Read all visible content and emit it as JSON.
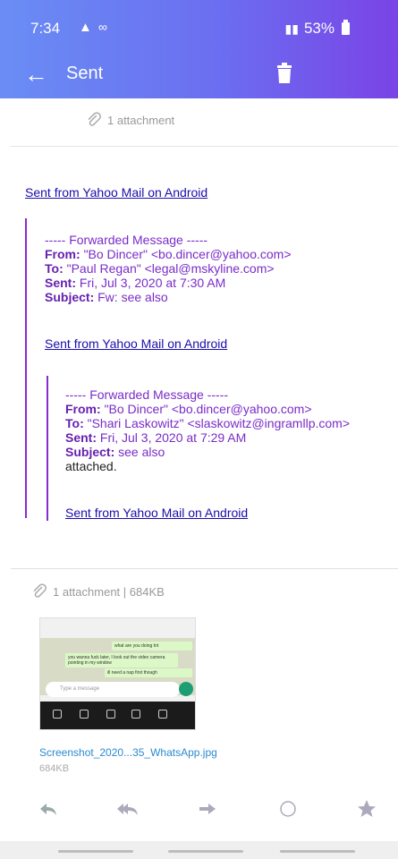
{
  "status": {
    "time": "7:34",
    "battery": "53%"
  },
  "nav": {
    "title": "Sent"
  },
  "top_attachment": "1 attachment",
  "links": {
    "sent_from_1": "Sent from Yahoo Mail on Android",
    "sent_from_2": "Sent from Yahoo Mail on Android",
    "sent_from_3": "Sent from Yahoo Mail on Android"
  },
  "fwd1": {
    "header": "----- Forwarded Message -----",
    "from_label": "From:",
    "from": "\"Bo Dincer\" <bo.dincer@yahoo.com>",
    "to_label": "To:",
    "to": "\"Paul Regan\" <legal@mskyline.com>",
    "sent_label": "Sent:",
    "sent": "Fri, Jul 3, 2020 at 7:30 AM",
    "subject_label": "Subject:",
    "subject": "Fw: see also"
  },
  "fwd2": {
    "header": "----- Forwarded Message -----",
    "from_label": "From:",
    "from": "\"Bo Dincer\" <bo.dincer@yahoo.com>",
    "to_label": "To:",
    "to": "\"Shari Laskowitz\" <slaskowitz@ingramllp.com>",
    "sent_label": "Sent:",
    "sent": "Fri, Jul 3, 2020 at 7:29 AM",
    "subject_label": "Subject:",
    "subject": "see also",
    "body": "attached."
  },
  "attachments": {
    "summary": "1 attachment | 684KB",
    "file_name": "Screenshot_2020...35_WhatsApp.jpg",
    "file_size": "684KB",
    "thumbnail": {
      "msg1": "what are you doing tnt",
      "msg2": "you wanna fuck later, I look out the video camera pointing in my window",
      "msg3": "ill need a nap first though",
      "composer_placeholder": "Type a message"
    }
  },
  "actions": [
    "reply",
    "reply-all",
    "forward",
    "mark-unread",
    "star"
  ],
  "colors": {
    "header_start": "#6a8df4",
    "header_end": "#7a43e6",
    "quote_bar": "#8a2bd0",
    "link": "#1a0dab"
  }
}
